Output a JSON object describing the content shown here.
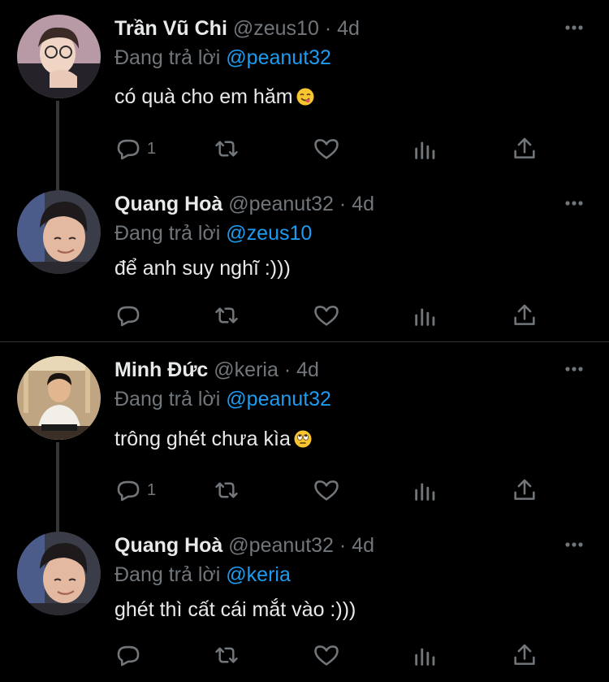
{
  "tweets": [
    {
      "name": "Trần Vũ Chi",
      "handle": "@zeus10",
      "separator": "·",
      "time": "4d",
      "reply_prefix": "Đang trả lời",
      "reply_to": "@peanut32",
      "text": "có quà cho em hăm",
      "emoji": "yum-face-emoji",
      "reply_count": "1"
    },
    {
      "name": "Quang Hoà",
      "handle": "@peanut32",
      "separator": "·",
      "time": "4d",
      "reply_prefix": "Đang trả lời",
      "reply_to": "@zeus10",
      "text": "để anh suy nghĩ :)))",
      "reply_count": ""
    },
    {
      "name": "Minh Đức",
      "handle": "@keria",
      "separator": "·",
      "time": "4d",
      "reply_prefix": "Đang trả lời",
      "reply_to": "@peanut32",
      "text": "trông ghét chưa kìa",
      "emoji": "rolling-eyes-emoji",
      "reply_count": "1"
    },
    {
      "name": "Quang Hoà",
      "handle": "@peanut32",
      "separator": "·",
      "time": "4d",
      "reply_prefix": "Đang trả lời",
      "reply_to": "@keria",
      "text": "ghét thì cất cái mắt vào :)))",
      "reply_count": ""
    }
  ],
  "icons": {
    "reply": "reply-icon",
    "retweet": "retweet-icon",
    "like": "like-icon",
    "views": "views-icon",
    "share": "share-icon",
    "more": "more-icon"
  },
  "colors": {
    "background": "#000000",
    "text": "#e7e9ea",
    "secondary": "#71767b",
    "accent": "#1d9bf0",
    "divider": "#2f3336",
    "thread_line": "#333639"
  }
}
